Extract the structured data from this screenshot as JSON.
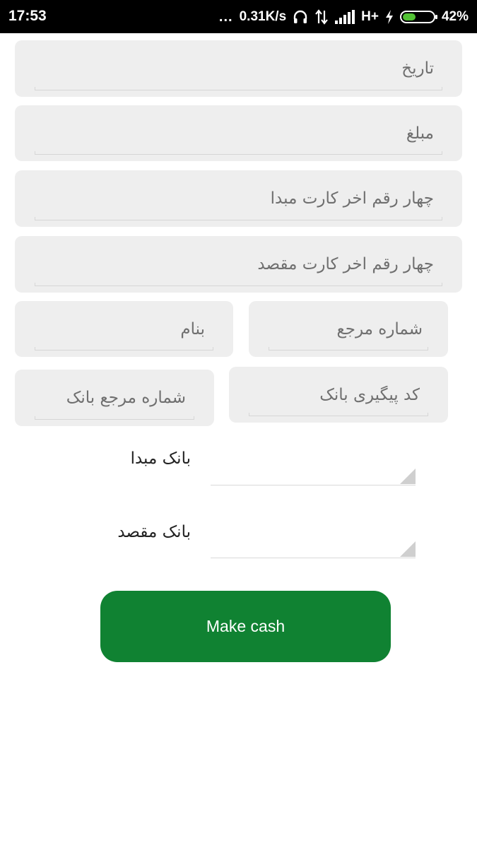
{
  "status_bar": {
    "time": "17:53",
    "dots": "...",
    "speed": "0.31K/s",
    "network_type": "H+",
    "battery_percent": "42%",
    "battery_level": 0.42,
    "battery_color": "#52c234"
  },
  "form": {
    "date_placeholder": "تاریخ",
    "amount_placeholder": "مبلغ",
    "source_card_last4_placeholder": "چهار رقم اخر کارت مبدا",
    "dest_card_last4_placeholder": "چهار رقم اخر کارت مقصد",
    "name_placeholder": "بنام",
    "reference_number_placeholder": "شماره مرجع",
    "bank_reference_number_placeholder": "شماره مرجع بانک",
    "bank_tracking_code_placeholder": "کد پیگیری بانک",
    "source_bank_label": "بانک مبدا",
    "dest_bank_label": "بانک مقصد"
  },
  "actions": {
    "submit_label": "Make cash",
    "submit_color": "#108232"
  },
  "icons": [
    "headset-icon",
    "data-arrows-icon",
    "signal-icon",
    "charging-icon",
    "battery-icon",
    "dropdown-icon"
  ]
}
